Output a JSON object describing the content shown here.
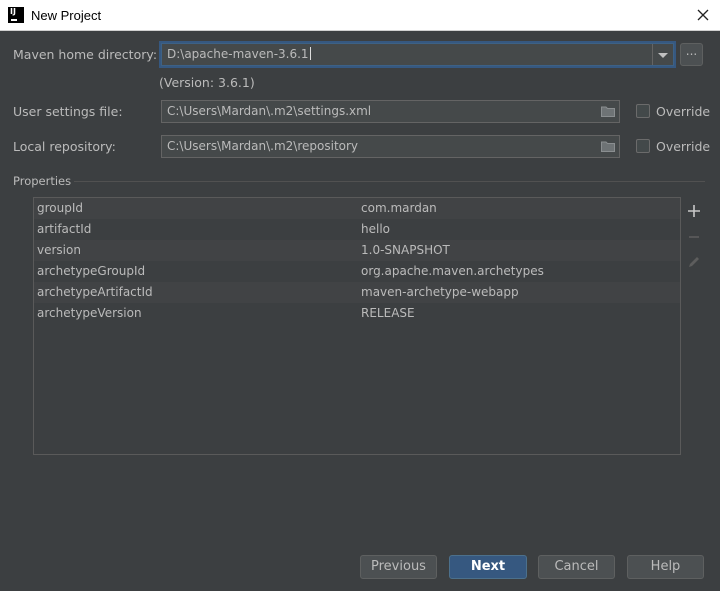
{
  "window": {
    "title": "New Project",
    "app_icon_text": "IJ"
  },
  "maven_home": {
    "label": "Maven home directory:",
    "value": "D:\\apache-maven-3.6.1",
    "version": "(Version: 3.6.1)",
    "browse_label": "..."
  },
  "user_settings": {
    "label": "User settings file:",
    "value": "C:\\Users\\Mardan\\.m2\\settings.xml",
    "override_label": "Override"
  },
  "local_repo": {
    "label": "Local repository:",
    "value": "C:\\Users\\Mardan\\.m2\\repository",
    "override_label": "Override"
  },
  "properties": {
    "title": "Properties",
    "rows": [
      {
        "key": "groupId",
        "value": "com.mardan"
      },
      {
        "key": "artifactId",
        "value": "hello"
      },
      {
        "key": "version",
        "value": "1.0-SNAPSHOT"
      },
      {
        "key": "archetypeGroupId",
        "value": "org.apache.maven.archetypes"
      },
      {
        "key": "archetypeArtifactId",
        "value": "maven-archetype-webapp"
      },
      {
        "key": "archetypeVersion",
        "value": "RELEASE"
      }
    ]
  },
  "buttons": {
    "previous": "Previous",
    "next": "Next",
    "cancel": "Cancel",
    "help": "Help"
  },
  "colors": {
    "background": "#3c3f41",
    "primary": "#365880",
    "focus": "#3d6185"
  }
}
